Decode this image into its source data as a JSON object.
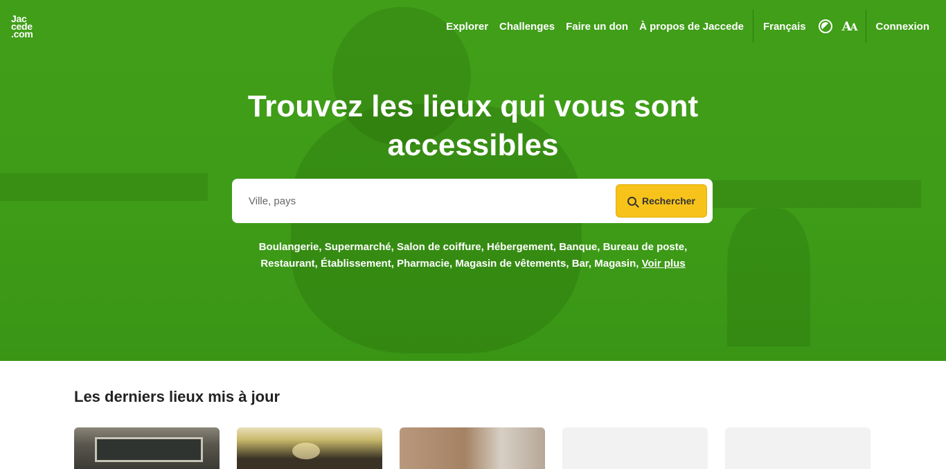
{
  "logo": {
    "line1": "Jac",
    "line2": "cede",
    "line3": ".com"
  },
  "nav": {
    "explorer": "Explorer",
    "challenges": "Challenges",
    "donate": "Faire un don",
    "about": "À propos de Jaccede",
    "language": "Français",
    "contrast_icon": "contrast-icon",
    "font_size_icon": "font-size-icon",
    "login": "Connexion"
  },
  "hero": {
    "title": "Trouvez les lieux qui vous sont accessibles",
    "search": {
      "placeholder": "Ville, pays",
      "button_label": "Rechercher",
      "button_icon": "search-icon",
      "button_color": "#f7c31a"
    },
    "categories": [
      "Boulangerie",
      "Supermarché",
      "Salon de coiffure",
      "Hébergement",
      "Banque",
      "Bureau de poste",
      "Restaurant",
      "Établissement",
      "Pharmacie",
      "Magasin de vêtements",
      "Bar",
      "Magasin"
    ],
    "see_more": "Voir plus",
    "background_color": "#3e9c18"
  },
  "latest": {
    "title": "Les derniers lieux mis à jour"
  }
}
